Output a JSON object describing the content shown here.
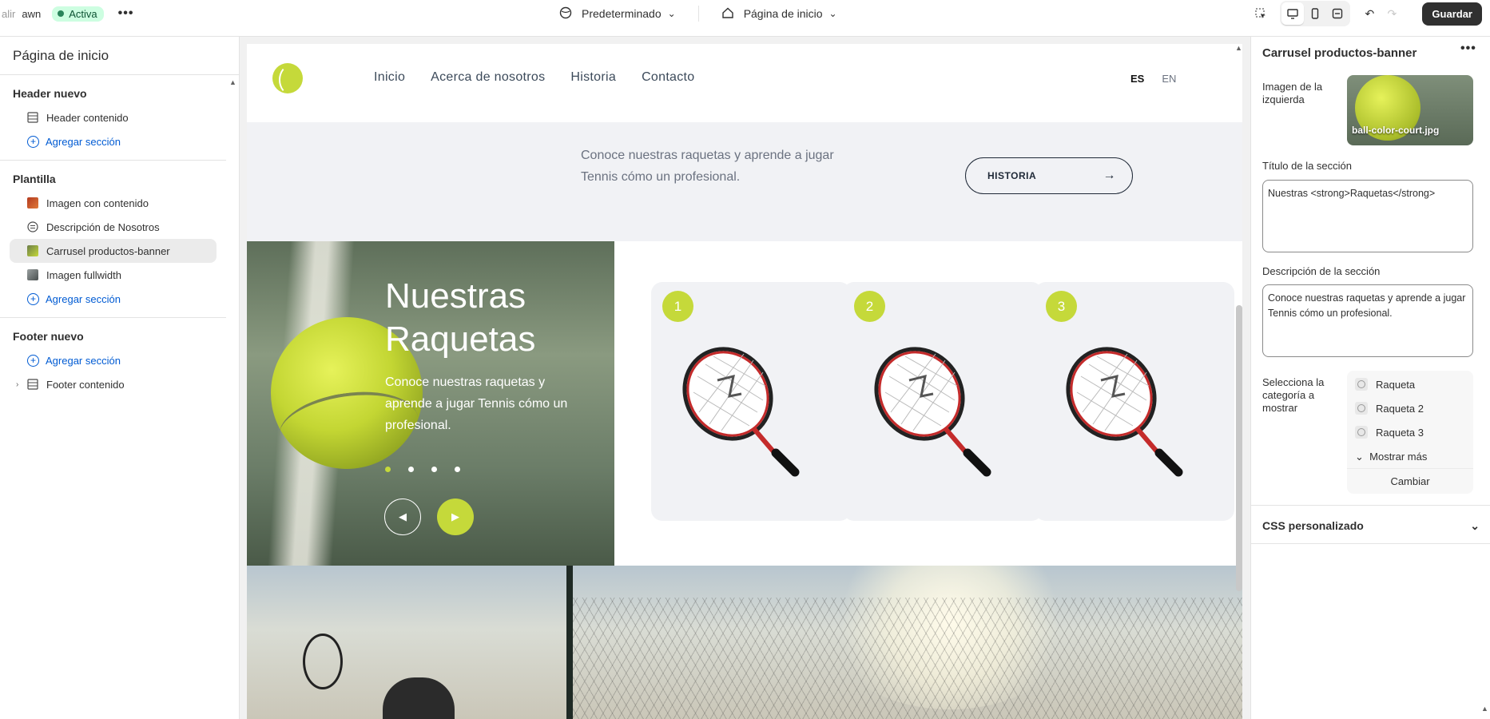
{
  "topbar": {
    "exit_label": "alir",
    "store_name": "awn",
    "status_badge": "Activa",
    "theme_label": "Predeterminado",
    "page_label": "Página de inicio",
    "save_label": "Guardar"
  },
  "sidebar": {
    "title": "Página de inicio",
    "groups": [
      {
        "label": "Header nuevo",
        "items": [
          {
            "label": "Header contenido"
          }
        ],
        "add_label": "Agregar sección"
      },
      {
        "label": "Plantilla",
        "items": [
          {
            "label": "Imagen con contenido"
          },
          {
            "label": "Descripción de Nosotros"
          },
          {
            "label": "Carrusel productos-banner",
            "selected": true
          },
          {
            "label": "Imagen fullwidth"
          }
        ],
        "add_label": "Agregar sección"
      },
      {
        "label": "Footer nuevo",
        "add_label": "Agregar sección",
        "items": [
          {
            "label": "Footer contenido"
          }
        ]
      }
    ]
  },
  "site": {
    "nav": [
      "Inicio",
      "Acerca de nosotros",
      "Historia",
      "Contacto"
    ],
    "languages": [
      "ES",
      "EN"
    ],
    "intro_text": "Conoce nuestras raquetas y aprende a jugar Tennis cómo un profesional.",
    "intro_button": "HISTORIA",
    "banner_title_line1": "Nuestras",
    "banner_title_line2": "Raquetas",
    "banner_desc": "Conoce nuestras raquetas y aprende a jugar Tennis cómo un profesional.",
    "cards": [
      "1",
      "2",
      "3"
    ]
  },
  "inspector": {
    "title": "Carrusel productos-banner",
    "image_label": "Imagen de la izquierda",
    "image_filename": "ball-color-court.jpg",
    "section_title_label": "Título de la sección",
    "section_title_value": "Nuestras <strong>Raquetas</strong>",
    "section_desc_label": "Descripción de la sección",
    "section_desc_value": "Conoce nuestras raquetas y aprende a jugar Tennis cómo un profesional.",
    "category_label": "Selecciona la categoría a mostrar",
    "categories": [
      "Raqueta",
      "Raqueta 2",
      "Raqueta 3"
    ],
    "show_more": "Mostrar más",
    "change_label": "Cambiar",
    "css_label": "CSS personalizado"
  },
  "colors": {
    "accent": "#c5d93a",
    "link": "#005bd3",
    "save_bg": "#303030"
  },
  "icons": [
    "globe-icon",
    "home-icon",
    "chevron-down-icon",
    "inspector-icon",
    "desktop-icon",
    "mobile-icon",
    "fullwidth-icon",
    "undo-icon",
    "redo-icon",
    "plus-circle-icon",
    "more-icon",
    "arrow-right-icon"
  ]
}
